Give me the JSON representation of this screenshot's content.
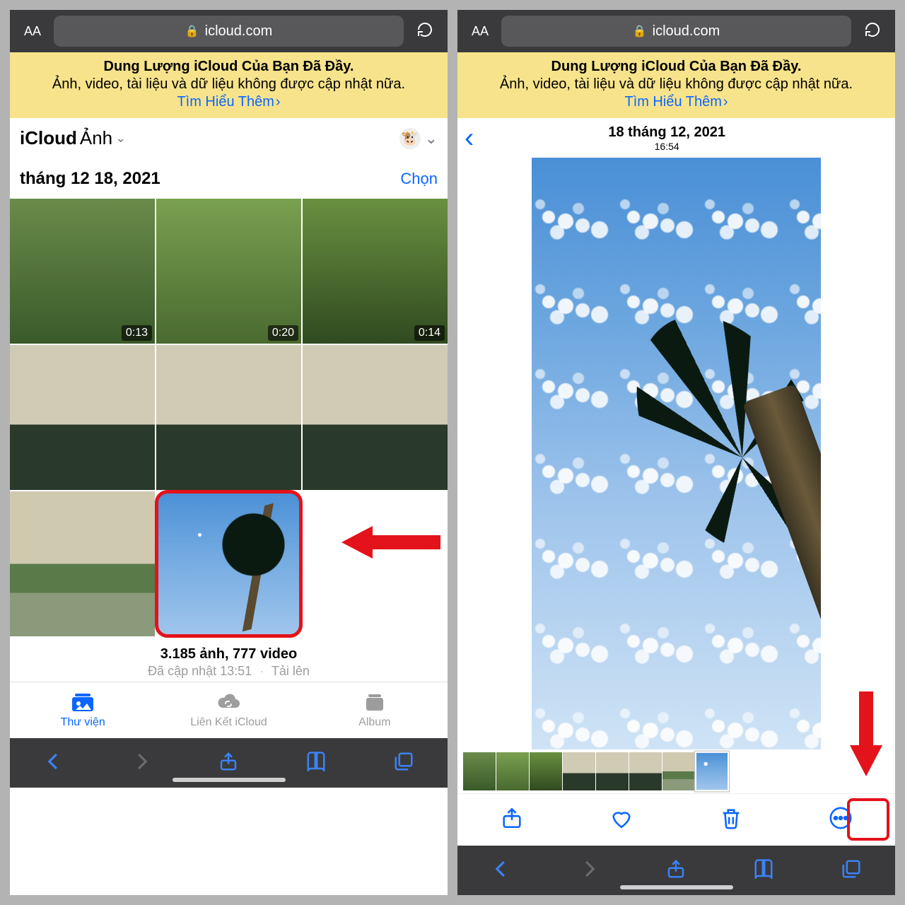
{
  "addressBar": {
    "aa": "AA",
    "domain": "icloud.com"
  },
  "banner": {
    "titleBold": "Dung Lượng iCloud Của Bạn Đã Đầy.",
    "body": "Ảnh, video, tài liệu và dữ liệu không được cập nhật nữa.",
    "link": "Tìm Hiểu Thêm"
  },
  "screen1": {
    "navPrefix": "iCloud",
    "navTitle": "Ảnh",
    "avatarEmoji": "🐮",
    "dateLabel": "tháng 12 18, 2021",
    "selectLabel": "Chọn",
    "durations": [
      "0:13",
      "0:20",
      "0:14"
    ],
    "statsMain": "3.185 ảnh, 777 video",
    "statsUpdated": "Đã cập nhật 13:51",
    "statsUploading": "Tải lên",
    "tabs": {
      "library": "Thư viện",
      "links": "Liên Kết iCloud",
      "albums": "Album"
    }
  },
  "screen2": {
    "date": "18 tháng 12, 2021",
    "time": "16:54"
  }
}
